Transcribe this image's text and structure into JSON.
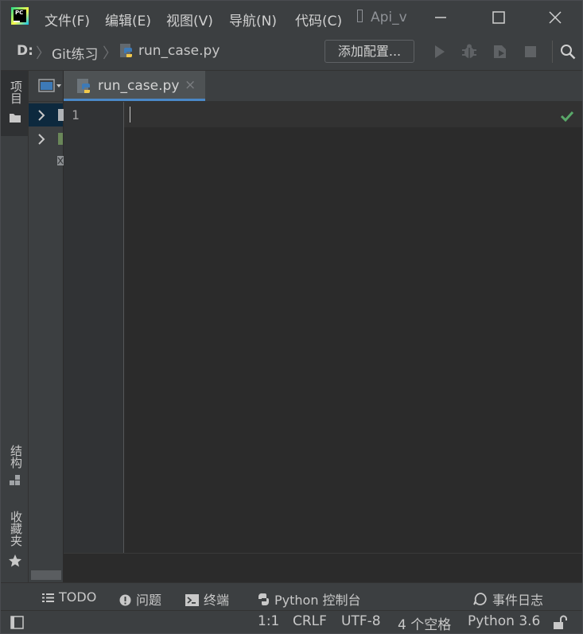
{
  "app": {
    "logo_text": "PC",
    "project_title": "Api_v"
  },
  "menu": [
    "文件(F)",
    "编辑(E)",
    "视图(V)",
    "导航(N)",
    "代码(C)"
  ],
  "breadcrumb": {
    "drive": "D:",
    "folder": "Git练习",
    "file": "run_case.py"
  },
  "toolbar": {
    "add_config_label": "添加配置..."
  },
  "left_stripe": {
    "project_label": "项目",
    "structure_label": "结构",
    "favorites_label": "收藏夹"
  },
  "editor": {
    "tab_label": "run_case.py",
    "tab_close": "×",
    "line_numbers": [
      "1"
    ],
    "inspection_status": "ok"
  },
  "tool_windows": [
    {
      "label": "TODO",
      "icon": "list-icon"
    },
    {
      "label": "问题",
      "icon": "problems-icon"
    },
    {
      "label": "终端",
      "icon": "terminal-icon"
    },
    {
      "label": "Python 控制台",
      "icon": "python-icon"
    },
    {
      "label": "事件日志",
      "icon": "event-log-icon"
    }
  ],
  "status": {
    "position": "1:1",
    "line_separator": "CRLF",
    "encoding": "UTF-8",
    "indent": "4 个空格",
    "interpreter": "Python 3.6"
  },
  "colors": {
    "accent": "#4a88c7",
    "ok_check": "#59a869",
    "chrome": "#3c3f41",
    "editor_bg": "#2b2b2b"
  }
}
